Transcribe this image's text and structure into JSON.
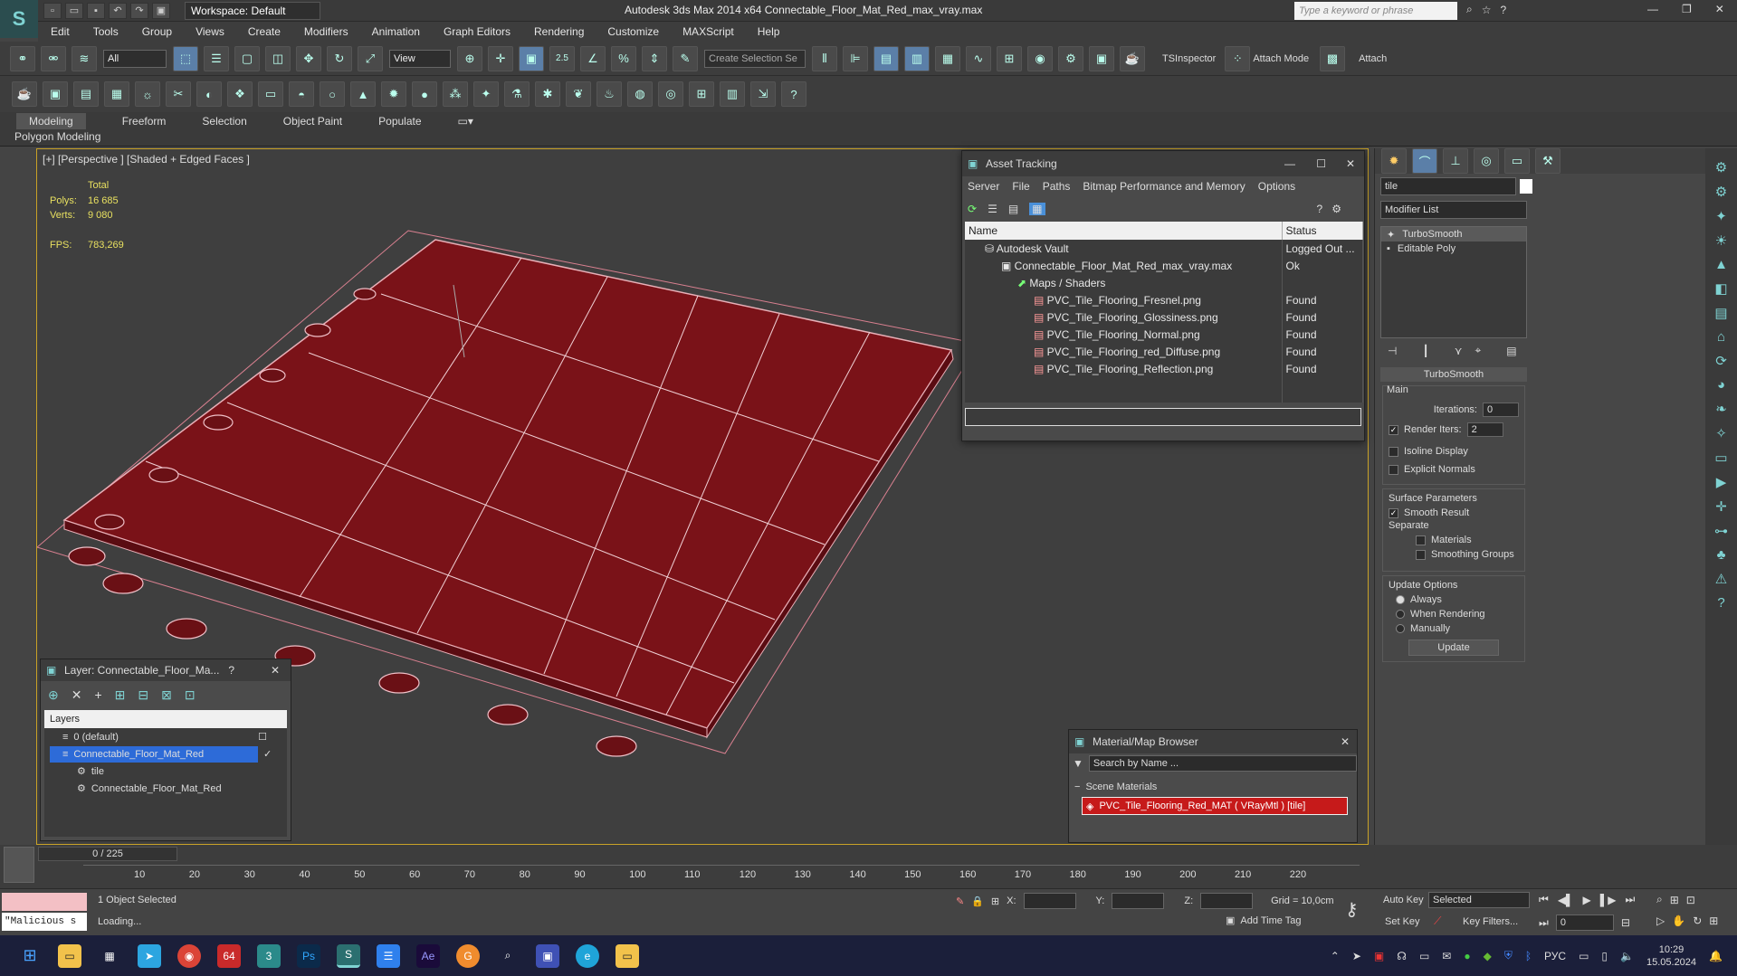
{
  "titlebar": {
    "workspace": "Workspace: Default",
    "title": "Autodesk 3ds Max  2014 x64     Connectable_Floor_Mat_Red_max_vray.max",
    "search_placeholder": "Type a keyword or phrase"
  },
  "menu": [
    "Edit",
    "Tools",
    "Group",
    "Views",
    "Create",
    "Modifiers",
    "Animation",
    "Graph Editors",
    "Rendering",
    "Customize",
    "MAXScript",
    "Help"
  ],
  "toolbar": {
    "selection_filter": "All",
    "ref_coord": "View",
    "snap_value": "2.5",
    "selection_set_placeholder": "Create Selection Se",
    "tsinspector": "TSInspector",
    "attach_mode": "Attach Mode",
    "attach": "Attach"
  },
  "ribbon": {
    "tabs": [
      "Modeling",
      "Freeform",
      "Selection",
      "Object Paint",
      "Populate"
    ],
    "sub": "Polygon Modeling"
  },
  "viewport": {
    "label": "[+] [Perspective ] [Shaded + Edged Faces ]",
    "total_label": "Total",
    "polys_label": "Polys:",
    "polys_value": "16 685",
    "verts_label": "Verts:",
    "verts_value": "9 080",
    "fps_label": "FPS:",
    "fps_value": "783,269"
  },
  "asset_tracking": {
    "title": "Asset Tracking",
    "menu": [
      "Server",
      "File",
      "Paths",
      "Bitmap Performance and Memory",
      "Options"
    ],
    "col_name": "Name",
    "col_status": "Status",
    "rows": [
      {
        "name": "Autodesk Vault",
        "status": "Logged Out ..."
      },
      {
        "name": "Connectable_Floor_Mat_Red_max_vray.max",
        "status": "Ok"
      },
      {
        "name": "Maps / Shaders",
        "status": ""
      },
      {
        "name": "PVC_Tile_Flooring_Fresnel.png",
        "status": "Found"
      },
      {
        "name": "PVC_Tile_Flooring_Glossiness.png",
        "status": "Found"
      },
      {
        "name": "PVC_Tile_Flooring_Normal.png",
        "status": "Found"
      },
      {
        "name": "PVC_Tile_Flooring_red_Diffuse.png",
        "status": "Found"
      },
      {
        "name": "PVC_Tile_Flooring_Reflection.png",
        "status": "Found"
      }
    ]
  },
  "command_panel": {
    "object_name": "tile",
    "modifier_list": "Modifier List",
    "stack": [
      "TurboSmooth",
      "Editable Poly"
    ],
    "rollout_title": "TurboSmooth",
    "main_label": "Main",
    "iterations_label": "Iterations:",
    "iterations_value": "0",
    "render_iters_label": "Render Iters:",
    "render_iters_value": "2",
    "isoline": "Isoline Display",
    "explicit": "Explicit Normals",
    "surface_params": "Surface Parameters",
    "smooth_result": "Smooth Result",
    "separate": "Separate",
    "materials": "Materials",
    "smoothing_groups": "Smoothing Groups",
    "update_options": "Update Options",
    "always": "Always",
    "when_rendering": "When Rendering",
    "manually": "Manually",
    "update_btn": "Update"
  },
  "layer_window": {
    "title": "Layer: Connectable_Floor_Ma...",
    "help": "?",
    "header": "Layers",
    "items": [
      "0 (default)",
      "Connectable_Floor_Mat_Red",
      "tile",
      "Connectable_Floor_Mat_Red"
    ]
  },
  "material_browser": {
    "title": "Material/Map Browser",
    "search_placeholder": "Search by Name ...",
    "section": "Scene Materials",
    "material": "PVC_Tile_Flooring_Red_MAT  ( VRayMtl )  [tile]"
  },
  "timeline": {
    "frame": "0 / 225",
    "ticks": [
      "10",
      "20",
      "30",
      "40",
      "50",
      "60",
      "70",
      "80",
      "90",
      "100",
      "110",
      "120",
      "130",
      "140",
      "150",
      "160",
      "170",
      "180",
      "190",
      "200",
      "210",
      "220"
    ]
  },
  "status": {
    "script": "\"Malicious s",
    "selected": "1 Object Selected",
    "loading": "Loading...",
    "x_label": "X:",
    "y_label": "Y:",
    "z_label": "Z:",
    "grid": "Grid = 10,0cm",
    "add_time_tag": "Add Time Tag",
    "auto_key": "Auto Key",
    "set_key": "Set Key",
    "selected_dd": "Selected",
    "key_filters": "Key Filters...",
    "frame_value": "0"
  },
  "taskbar": {
    "badge": "64",
    "lang": "РУС",
    "time": "10:29",
    "date": "15.05.2024"
  },
  "colors": {
    "accent": "#4a90d9",
    "floor": "#7a1218",
    "viewport_border": "#c9a227",
    "material_swatch": "#c61a1a"
  }
}
